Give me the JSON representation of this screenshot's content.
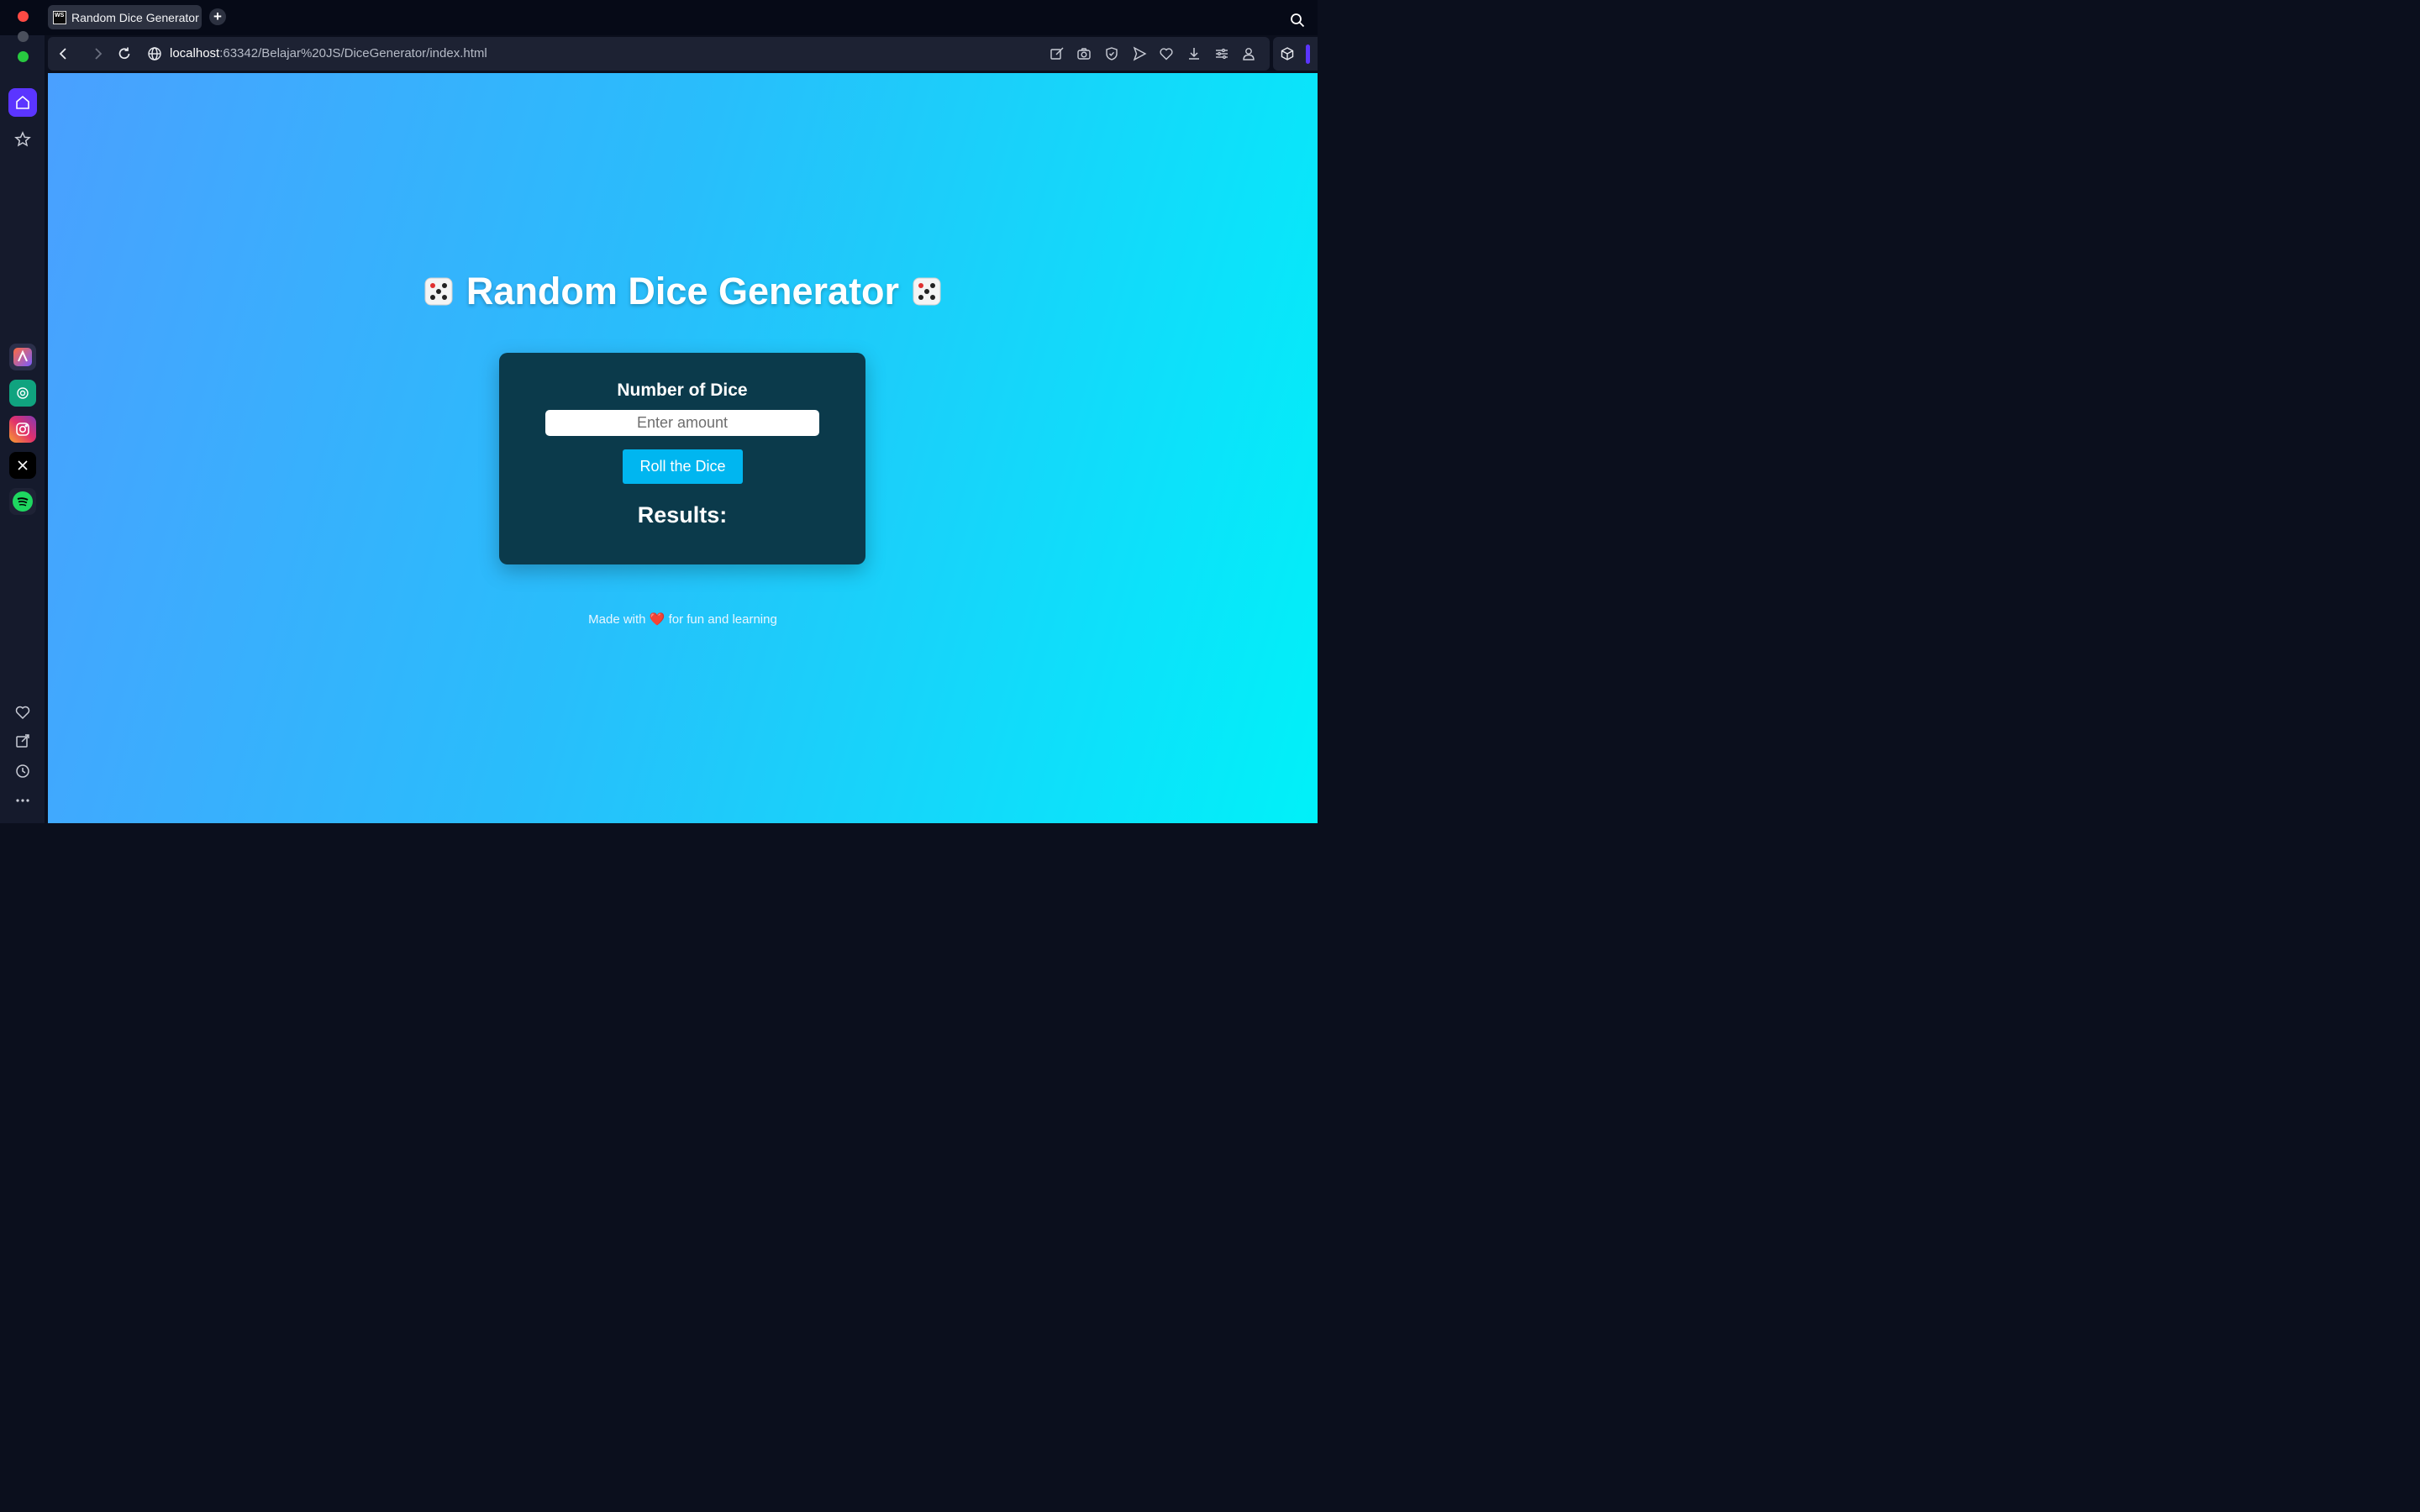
{
  "browser": {
    "tab": {
      "favicon_text": "WS",
      "title": "Random Dice Generator"
    },
    "address": {
      "host": "localhost",
      "path": ":63342/Belajar%20JS/DiceGenerator/index.html"
    },
    "accent_color": "#5b35ff",
    "toolbar_icons": [
      "edit-icon",
      "camera-icon",
      "shield-icon",
      "send-icon",
      "heart-icon",
      "download-icon",
      "settings-sliders-icon",
      "profile-icon",
      "cube-icon"
    ],
    "sidebar_top_icons": [
      "home-icon",
      "star-icon"
    ],
    "sidebar_apps": [
      "aria-app-icon",
      "chatgpt-app-icon",
      "instagram-app-icon",
      "x-app-icon",
      "spotify-app-icon"
    ],
    "sidebar_bottom_icons": [
      "heart-icon",
      "pin-icon",
      "history-icon",
      "more-icon"
    ]
  },
  "page": {
    "title": "Random Dice Generator",
    "card": {
      "label": "Number of Dice",
      "input_placeholder": "Enter amount",
      "input_value": "",
      "button_label": "Roll the Dice",
      "results_label": "Results:"
    },
    "footer": {
      "before": "Made with",
      "heart": "❤️",
      "after": "for fun and learning"
    },
    "colors": {
      "gradient_start": "#4aa0ff",
      "gradient_end": "#00f1f9",
      "card_bg": "#0b3a4b",
      "button_bg": "#00b6f0"
    }
  }
}
